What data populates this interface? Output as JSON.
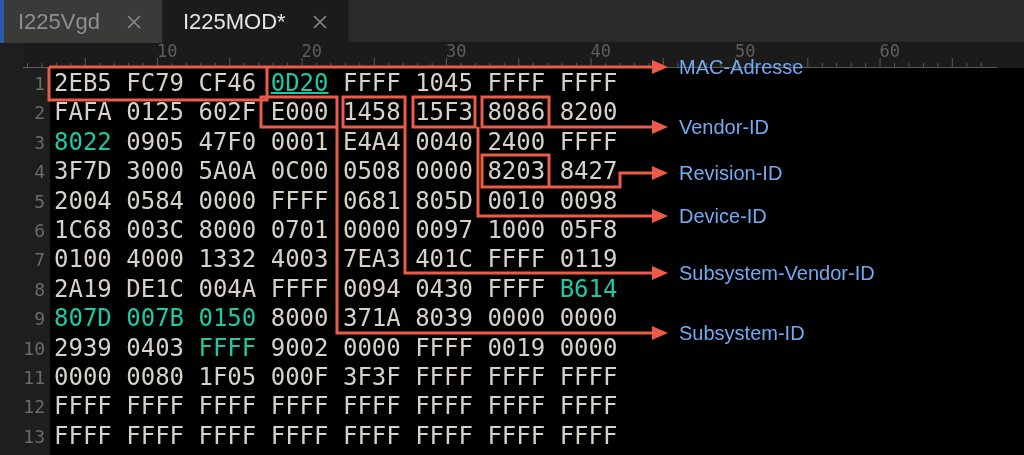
{
  "tabs": [
    {
      "label": "I225Vgd",
      "selected": false
    },
    {
      "label": "I225MOD*",
      "selected": true
    }
  ],
  "ruler": {
    "labels": [
      "10",
      "20",
      "30",
      "40",
      "50",
      "60"
    ]
  },
  "lines": [
    {
      "number": "1",
      "cells": [
        {
          "text": "2EB5",
          "highlighted": false,
          "underlined": false
        },
        {
          "text": "FC79",
          "highlighted": false,
          "underlined": false
        },
        {
          "text": "CF46",
          "highlighted": false,
          "underlined": false
        },
        {
          "text": "0D20",
          "highlighted": true,
          "underlined": true
        },
        {
          "text": "FFFF",
          "highlighted": false,
          "underlined": false
        },
        {
          "text": "1045",
          "highlighted": false,
          "underlined": false
        },
        {
          "text": "FFFF",
          "highlighted": false,
          "underlined": false
        },
        {
          "text": "FFFF",
          "highlighted": false,
          "underlined": false
        }
      ]
    },
    {
      "number": "2",
      "cells": [
        {
          "text": "FAFA",
          "highlighted": false,
          "underlined": false
        },
        {
          "text": "0125",
          "highlighted": false,
          "underlined": false
        },
        {
          "text": "602F",
          "highlighted": false,
          "underlined": false
        },
        {
          "text": "E000",
          "highlighted": false,
          "underlined": false
        },
        {
          "text": "1458",
          "highlighted": false,
          "underlined": false
        },
        {
          "text": "15F3",
          "highlighted": false,
          "underlined": false
        },
        {
          "text": "8086",
          "highlighted": false,
          "underlined": false
        },
        {
          "text": "8200",
          "highlighted": false,
          "underlined": false
        }
      ]
    },
    {
      "number": "3",
      "cells": [
        {
          "text": "8022",
          "highlighted": true,
          "underlined": false
        },
        {
          "text": "0905",
          "highlighted": false,
          "underlined": false
        },
        {
          "text": "47F0",
          "highlighted": false,
          "underlined": false
        },
        {
          "text": "0001",
          "highlighted": false,
          "underlined": false
        },
        {
          "text": "E4A4",
          "highlighted": false,
          "underlined": false
        },
        {
          "text": "0040",
          "highlighted": false,
          "underlined": false
        },
        {
          "text": "2400",
          "highlighted": false,
          "underlined": false
        },
        {
          "text": "FFFF",
          "highlighted": false,
          "underlined": false
        }
      ]
    },
    {
      "number": "4",
      "cells": [
        {
          "text": "3F7D",
          "highlighted": false,
          "underlined": false
        },
        {
          "text": "3000",
          "highlighted": false,
          "underlined": false
        },
        {
          "text": "5A0A",
          "highlighted": false,
          "underlined": false
        },
        {
          "text": "0C00",
          "highlighted": false,
          "underlined": false
        },
        {
          "text": "0508",
          "highlighted": false,
          "underlined": false
        },
        {
          "text": "0000",
          "highlighted": false,
          "underlined": false
        },
        {
          "text": "8203",
          "highlighted": false,
          "underlined": false
        },
        {
          "text": "8427",
          "highlighted": false,
          "underlined": false
        }
      ]
    },
    {
      "number": "5",
      "cells": [
        {
          "text": "2004",
          "highlighted": false,
          "underlined": false
        },
        {
          "text": "0584",
          "highlighted": false,
          "underlined": false
        },
        {
          "text": "0000",
          "highlighted": false,
          "underlined": false
        },
        {
          "text": "FFFF",
          "highlighted": false,
          "underlined": false
        },
        {
          "text": "0681",
          "highlighted": false,
          "underlined": false
        },
        {
          "text": "805D",
          "highlighted": false,
          "underlined": false
        },
        {
          "text": "0010",
          "highlighted": false,
          "underlined": false
        },
        {
          "text": "0098",
          "highlighted": false,
          "underlined": false
        }
      ]
    },
    {
      "number": "6",
      "cells": [
        {
          "text": "1C68",
          "highlighted": false,
          "underlined": false
        },
        {
          "text": "003C",
          "highlighted": false,
          "underlined": false
        },
        {
          "text": "8000",
          "highlighted": false,
          "underlined": false
        },
        {
          "text": "0701",
          "highlighted": false,
          "underlined": false
        },
        {
          "text": "0000",
          "highlighted": false,
          "underlined": false
        },
        {
          "text": "0097",
          "highlighted": false,
          "underlined": false
        },
        {
          "text": "1000",
          "highlighted": false,
          "underlined": false
        },
        {
          "text": "05F8",
          "highlighted": false,
          "underlined": false
        }
      ]
    },
    {
      "number": "7",
      "cells": [
        {
          "text": "0100",
          "highlighted": false,
          "underlined": false
        },
        {
          "text": "4000",
          "highlighted": false,
          "underlined": false
        },
        {
          "text": "1332",
          "highlighted": false,
          "underlined": false
        },
        {
          "text": "4003",
          "highlighted": false,
          "underlined": false
        },
        {
          "text": "7EA3",
          "highlighted": false,
          "underlined": false
        },
        {
          "text": "401C",
          "highlighted": false,
          "underlined": false
        },
        {
          "text": "FFFF",
          "highlighted": false,
          "underlined": false
        },
        {
          "text": "0119",
          "highlighted": false,
          "underlined": false
        }
      ]
    },
    {
      "number": "8",
      "cells": [
        {
          "text": "2A19",
          "highlighted": false,
          "underlined": false
        },
        {
          "text": "DE1C",
          "highlighted": false,
          "underlined": false
        },
        {
          "text": "004A",
          "highlighted": false,
          "underlined": false
        },
        {
          "text": "FFFF",
          "highlighted": false,
          "underlined": false
        },
        {
          "text": "0094",
          "highlighted": false,
          "underlined": false
        },
        {
          "text": "0430",
          "highlighted": false,
          "underlined": false
        },
        {
          "text": "FFFF",
          "highlighted": false,
          "underlined": false
        },
        {
          "text": "B614",
          "highlighted": true,
          "underlined": false
        }
      ]
    },
    {
      "number": "9",
      "cells": [
        {
          "text": "807D",
          "highlighted": true,
          "underlined": false
        },
        {
          "text": "007B",
          "highlighted": true,
          "underlined": false
        },
        {
          "text": "0150",
          "highlighted": true,
          "underlined": false
        },
        {
          "text": "8000",
          "highlighted": false,
          "underlined": false
        },
        {
          "text": "371A",
          "highlighted": false,
          "underlined": false
        },
        {
          "text": "8039",
          "highlighted": false,
          "underlined": false
        },
        {
          "text": "0000",
          "highlighted": false,
          "underlined": false
        },
        {
          "text": "0000",
          "highlighted": false,
          "underlined": false
        }
      ]
    },
    {
      "number": "10",
      "cells": [
        {
          "text": "2939",
          "highlighted": false,
          "underlined": false
        },
        {
          "text": "0403",
          "highlighted": false,
          "underlined": false
        },
        {
          "text": "FFFF",
          "highlighted": true,
          "underlined": false
        },
        {
          "text": "9002",
          "highlighted": false,
          "underlined": false
        },
        {
          "text": "0000",
          "highlighted": false,
          "underlined": false
        },
        {
          "text": "FFFF",
          "highlighted": false,
          "underlined": false
        },
        {
          "text": "0019",
          "highlighted": false,
          "underlined": false
        },
        {
          "text": "0000",
          "highlighted": false,
          "underlined": false
        }
      ]
    },
    {
      "number": "11",
      "cells": [
        {
          "text": "0000",
          "highlighted": false,
          "underlined": false
        },
        {
          "text": "0080",
          "highlighted": false,
          "underlined": false
        },
        {
          "text": "1F05",
          "highlighted": false,
          "underlined": false
        },
        {
          "text": "000F",
          "highlighted": false,
          "underlined": false
        },
        {
          "text": "3F3F",
          "highlighted": false,
          "underlined": false
        },
        {
          "text": "FFFF",
          "highlighted": false,
          "underlined": false
        },
        {
          "text": "FFFF",
          "highlighted": false,
          "underlined": false
        },
        {
          "text": "FFFF",
          "highlighted": false,
          "underlined": false
        }
      ]
    },
    {
      "number": "12",
      "cells": [
        {
          "text": "FFFF",
          "highlighted": false,
          "underlined": false
        },
        {
          "text": "FFFF",
          "highlighted": false,
          "underlined": false
        },
        {
          "text": "FFFF",
          "highlighted": false,
          "underlined": false
        },
        {
          "text": "FFFF",
          "highlighted": false,
          "underlined": false
        },
        {
          "text": "FFFF",
          "highlighted": false,
          "underlined": false
        },
        {
          "text": "FFFF",
          "highlighted": false,
          "underlined": false
        },
        {
          "text": "FFFF",
          "highlighted": false,
          "underlined": false
        },
        {
          "text": "FFFF",
          "highlighted": false,
          "underlined": false
        }
      ]
    },
    {
      "number": "13",
      "cells": [
        {
          "text": "FFFF",
          "highlighted": false,
          "underlined": false
        },
        {
          "text": "FFFF",
          "highlighted": false,
          "underlined": false
        },
        {
          "text": "FFFF",
          "highlighted": false,
          "underlined": false
        },
        {
          "text": "FFFF",
          "highlighted": false,
          "underlined": false
        },
        {
          "text": "FFFF",
          "highlighted": false,
          "underlined": false
        },
        {
          "text": "FFFF",
          "highlighted": false,
          "underlined": false
        },
        {
          "text": "FFFF",
          "highlighted": false,
          "underlined": false
        },
        {
          "text": "FFFF",
          "highlighted": false,
          "underlined": false
        }
      ]
    }
  ],
  "annotations": [
    {
      "label": "MAC-Adresse"
    },
    {
      "label": "Vendor-ID"
    },
    {
      "label": "Revision-ID"
    },
    {
      "label": "Device-ID"
    },
    {
      "label": "Subsystem-Vendor-ID"
    },
    {
      "label": "Subsystem-ID"
    }
  ]
}
